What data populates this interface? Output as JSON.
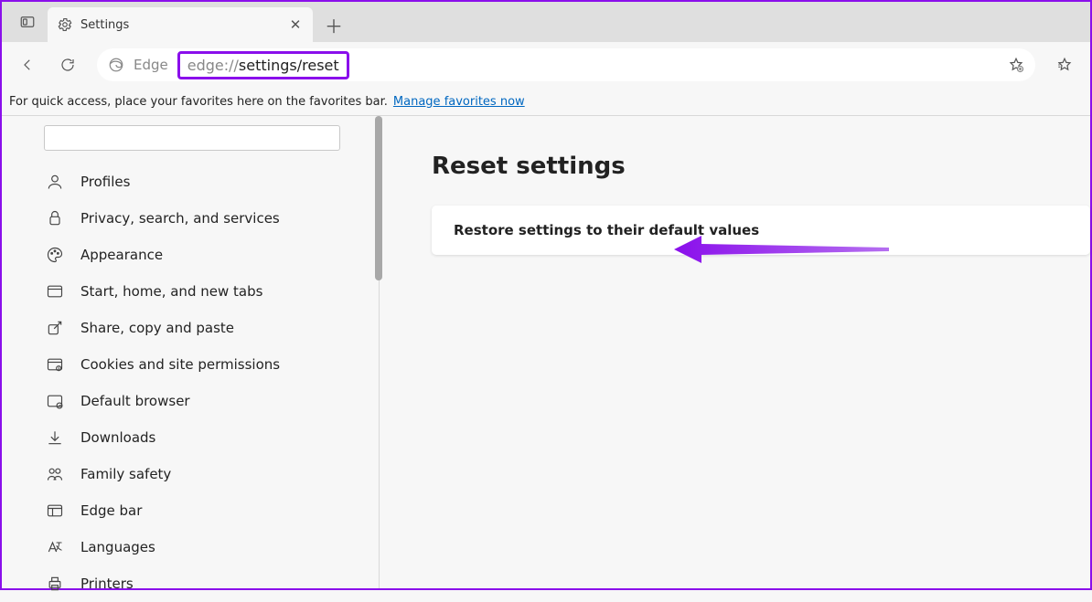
{
  "tab": {
    "title": "Settings"
  },
  "toolbar": {
    "edge_label": "Edge",
    "url_protocol": "edge://",
    "url_path": "settings/reset"
  },
  "fav_bar": {
    "hint": "For quick access, place your favorites here on the favorites bar.",
    "link": "Manage favorites now"
  },
  "sidebar": {
    "items": [
      {
        "label": "Profiles",
        "icon": "profile-icon"
      },
      {
        "label": "Privacy, search, and services",
        "icon": "lock-icon"
      },
      {
        "label": "Appearance",
        "icon": "palette-icon"
      },
      {
        "label": "Start, home, and new tabs",
        "icon": "tabs-icon"
      },
      {
        "label": "Share, copy and paste",
        "icon": "share-icon"
      },
      {
        "label": "Cookies and site permissions",
        "icon": "cookie-icon"
      },
      {
        "label": "Default browser",
        "icon": "browser-icon"
      },
      {
        "label": "Downloads",
        "icon": "download-icon"
      },
      {
        "label": "Family safety",
        "icon": "family-icon"
      },
      {
        "label": "Edge bar",
        "icon": "edgebar-icon"
      },
      {
        "label": "Languages",
        "icon": "language-icon"
      },
      {
        "label": "Printers",
        "icon": "printer-icon"
      }
    ]
  },
  "main": {
    "heading": "Reset settings",
    "restore_label": "Restore settings to their default values"
  }
}
